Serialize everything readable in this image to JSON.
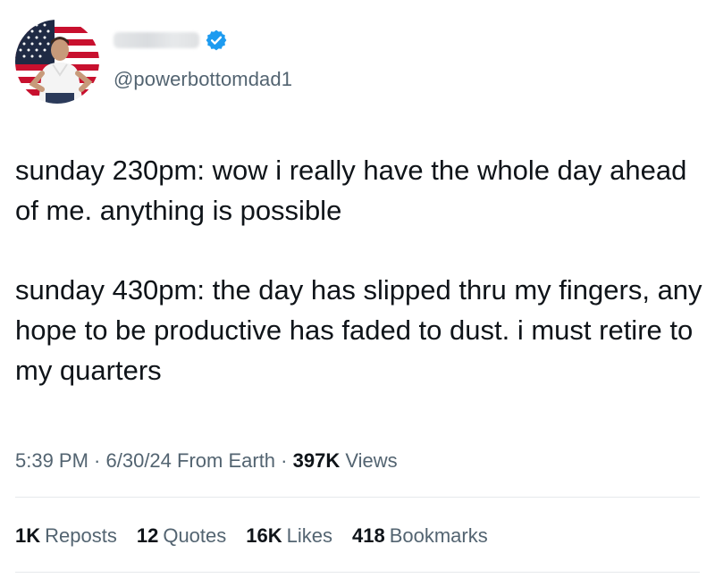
{
  "author": {
    "handle": "@powerbottomdad1",
    "verified": true,
    "verified_color": "#1d9bf0",
    "avatar_icon": "flag-portrait-avatar"
  },
  "post": {
    "paragraphs": [
      "sunday 230pm: wow i really have the whole day ahead of me. anything is possible",
      "sunday 430pm: the day has slipped thru my fingers, any hope to be productive has faded to dust. i must retire to my quarters"
    ]
  },
  "meta": {
    "time": "5:39 PM",
    "sep1": " · ",
    "date": "6/30/24",
    "source": " From Earth",
    "sep2": " · ",
    "views_count": "397K",
    "views_label": " Views"
  },
  "stats": {
    "reposts": {
      "count": "1K",
      "label": "Reposts"
    },
    "quotes": {
      "count": "12",
      "label": "Quotes"
    },
    "likes": {
      "count": "16K",
      "label": "Likes"
    },
    "bookmarks": {
      "count": "418",
      "label": "Bookmarks"
    }
  }
}
